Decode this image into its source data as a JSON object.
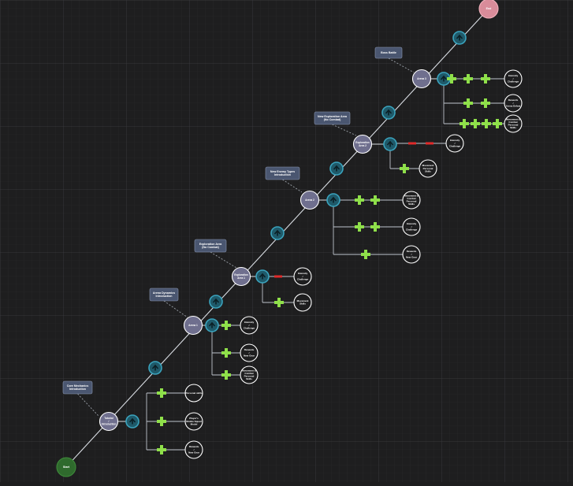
{
  "colors": {
    "background": "#1e1e1f",
    "grid_major": "#3c3c3f",
    "grid_minor": "#2a2a2c",
    "main_line": "#d9dde3",
    "branch_line": "#bfc4cc",
    "stage_node": "#6f6f8e",
    "node_outline": "#ffffff",
    "start_node": "#2f6a2d",
    "end_node": "#d98c9a",
    "connector_node": "#1f5a6a",
    "connector_ring": "#3aa3bd",
    "plus_icon": "#8fe04a",
    "minus_icon": "#e02a2a",
    "callout_box": "#4a5670",
    "leaf_node": "#1e1e1f"
  },
  "terminals": {
    "start": "Start",
    "end": "End"
  },
  "stages": [
    {
      "id": "tutorial",
      "lines": [
        "Tutorial",
        "/",
        "Introduction"
      ]
    },
    {
      "id": "arena1",
      "lines": [
        "Arena 1"
      ]
    },
    {
      "id": "explore1",
      "lines": [
        "Exploration",
        "Area 1"
      ]
    },
    {
      "id": "arena2",
      "lines": [
        "Arena 2"
      ]
    },
    {
      "id": "explore2",
      "lines": [
        "Exploration",
        "Area 2"
      ]
    },
    {
      "id": "arena3",
      "lines": [
        "Arena 3"
      ]
    }
  ],
  "callouts": [
    {
      "id": "core",
      "lines": [
        "Core Mechanics",
        "Introduction"
      ]
    },
    {
      "id": "arena-dyn",
      "lines": [
        "Arena Dynamics",
        "Introduction"
      ]
    },
    {
      "id": "explore-nocombat",
      "lines": [
        "Exploration Area",
        "(No Combat)"
      ]
    },
    {
      "id": "enemy-types",
      "lines": [
        "New Enemy Types",
        "Introduction"
      ]
    },
    {
      "id": "explore-nocombat-2",
      "lines": [
        "New  Exploration Area",
        "(No Combat)"
      ]
    },
    {
      "id": "boss",
      "lines": [
        "Boss Battle"
      ]
    }
  ],
  "outcomes": [
    {
      "id": "t1",
      "lines": [
        "Personal skills"
      ]
    },
    {
      "id": "t2",
      "lines": [
        "Player's",
        "Mobile Squad",
        "Model"
      ]
    },
    {
      "id": "t3",
      "lines": [
        "Rewards",
        "/",
        "New Gear"
      ]
    },
    {
      "id": "a1a",
      "lines": [
        "Intensity",
        "/",
        "Challenge"
      ]
    },
    {
      "id": "a1b",
      "lines": [
        "Rewards",
        "/",
        "New Gear"
      ]
    },
    {
      "id": "a1c",
      "lines": [
        "Movement &",
        "Combat",
        "Personal",
        "Skills"
      ]
    },
    {
      "id": "e1a",
      "lines": [
        "Intensity",
        "/",
        "Challenge"
      ]
    },
    {
      "id": "e1b",
      "lines": [
        "Movement",
        "Skills"
      ]
    },
    {
      "id": "a2a",
      "lines": [
        "Movement &",
        "Combat",
        "Personal",
        "Skills"
      ]
    },
    {
      "id": "a2b",
      "lines": [
        "Intensity",
        "/",
        "Challenge"
      ]
    },
    {
      "id": "a2c",
      "lines": [
        "Rewards",
        "/",
        "New Gear"
      ]
    },
    {
      "id": "e2a",
      "lines": [
        "Intensity",
        "/",
        "Challenge"
      ]
    },
    {
      "id": "e2b",
      "lines": [
        "Movement",
        "Personal",
        "Skills"
      ]
    },
    {
      "id": "a3a",
      "lines": [
        "Intensity",
        "/",
        "Challenge"
      ]
    },
    {
      "id": "a3b",
      "lines": [
        "Rewards",
        "/",
        "Arena Defeat"
      ]
    },
    {
      "id": "a3c",
      "lines": [
        "Movement &",
        "Combat",
        "Personal",
        "Skills"
      ]
    }
  ]
}
